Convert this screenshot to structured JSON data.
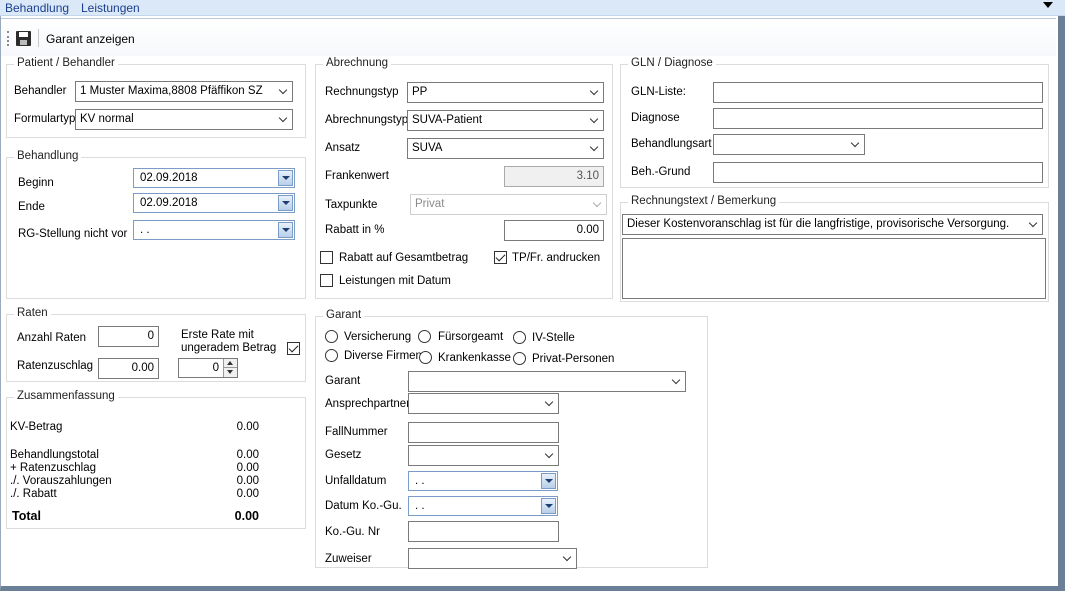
{
  "menu": {
    "behandlung": "Behandlung",
    "leistungen": "Leistungen"
  },
  "toolbar": {
    "garant_button": "Garant anzeigen"
  },
  "patient": {
    "legend": "Patient / Behandler",
    "behandler_label": "Behandler",
    "behandler_value": "1 Muster Maxima,8808 Pfäffikon SZ",
    "formulartyp_label": "Formulartyp",
    "formulartyp_value": "KV normal"
  },
  "behandlung": {
    "legend": "Behandlung",
    "beginn_label": "Beginn",
    "beginn_value": "02.09.2018",
    "ende_label": "Ende",
    "ende_value": "02.09.2018",
    "rg_label": "RG-Stellung nicht vor",
    "rg_value": " .  ."
  },
  "raten": {
    "legend": "Raten",
    "anzahl_label": "Anzahl Raten",
    "anzahl_value": "0",
    "erste_rate_label": "Erste Rate mit ungeradem Betrag",
    "erste_rate_checked": true,
    "zuschlag_label": "Ratenzuschlag",
    "zuschlag_value": "0.00",
    "spin_value": "0"
  },
  "zusammenfassung": {
    "legend": "Zusammenfassung",
    "kv_label": "KV-Betrag",
    "kv_value": "0.00",
    "behandlungstotal_label": "Behandlungstotal",
    "behandlungstotal_value": "0.00",
    "ratenzuschlag_label": "+ Ratenzuschlag",
    "ratenzuschlag_value": "0.00",
    "vorauszahlungen_label": "./. Vorauszahlungen",
    "vorauszahlungen_value": "0.00",
    "rabatt_label": "./. Rabatt",
    "rabatt_value": "0.00",
    "total_label": "Total",
    "total_value": "0.00"
  },
  "abrechnung": {
    "legend": "Abrechnung",
    "rechnungstyp_label": "Rechnungstyp",
    "rechnungstyp_value": "PP",
    "abrechnungstyp_label": "Abrechnungstyp",
    "abrechnungstyp_value": "SUVA-Patient",
    "ansatz_label": "Ansatz",
    "ansatz_value": "SUVA",
    "frankenwert_label": "Frankenwert",
    "frankenwert_value": "3.10",
    "taxpunkte_label": "Taxpunkte",
    "taxpunkte_value": "Privat",
    "rabatt_label": "Rabatt in %",
    "rabatt_value": "0.00",
    "rabatt_gesamt_label": "Rabatt auf Gesamtbetrag",
    "rabatt_gesamt_checked": false,
    "tp_label": "TP/Fr. andrucken",
    "tp_checked": true,
    "leistungen_datum_label": "Leistungen mit Datum",
    "leistungen_datum_checked": false
  },
  "gln": {
    "legend": "GLN / Diagnose",
    "liste_label": "GLN-Liste:",
    "liste_value": "",
    "diagnose_label": "Diagnose",
    "diagnose_value": "",
    "behandlungsart_label": "Behandlungsart",
    "behandlungsart_value": "",
    "grund_label": "Beh.-Grund",
    "grund_value": ""
  },
  "rechnungstext": {
    "legend": "Rechnungstext / Bemerkung",
    "text_value": "Dieser Kostenvoranschlag ist für die langfristige, provisorische Versorgung.",
    "bemerkung_value": ""
  },
  "garant": {
    "legend": "Garant",
    "radios": {
      "versicherung": "Versicherung",
      "fuersorgeamt": "Fürsorgeamt",
      "iv_stelle": "IV-Stelle",
      "diverse_firmen": "Diverse Firmen",
      "krankenkasse": "Krankenkasse",
      "privat_personen": "Privat-Personen"
    },
    "garant_label": "Garant",
    "garant_value": "",
    "ansprechpartner_label": "Ansprechpartner",
    "ansprechpartner_value": "",
    "fallnummer_label": "FallNummer",
    "fallnummer_value": "",
    "gesetz_label": "Gesetz",
    "gesetz_value": "",
    "unfalldatum_label": "Unfalldatum",
    "unfalldatum_value": " .  .",
    "datum_kogu_label": "Datum Ko.-Gu.",
    "datum_kogu_value": " .  .",
    "kogu_nr_label": "Ko.-Gu. Nr",
    "kogu_nr_value": "",
    "zuweiser_label": "Zuweiser",
    "zuweiser_value": ""
  }
}
